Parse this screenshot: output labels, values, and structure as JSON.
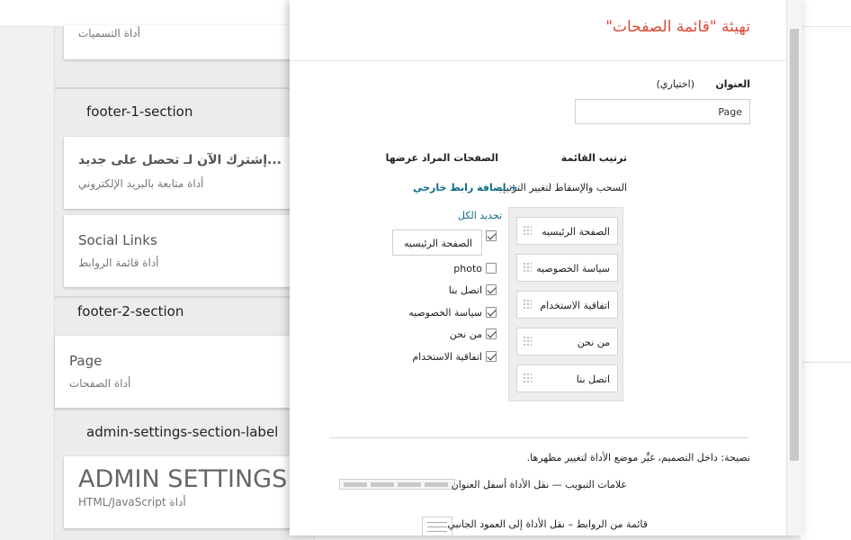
{
  "layout": {
    "gadgets": {
      "labels_gadget_subtitle": "أداة التسميات",
      "footer1_label": "footer-1-section",
      "follow_title": "إشترك الآن لـ تحصل على جديد...",
      "follow_subtitle": "أداة متابعة بالبريد الإلكتروني",
      "social_title": "Social Links",
      "social_subtitle": "أداة قائمة الروابط",
      "footer2_label": "footer-2-section",
      "page_title": "Page",
      "page_subtitle": "أداة الصفحات",
      "admin_label": "admin-settings-section-label",
      "admin_title": "ADMIN SETTINGS",
      "admin_subtitle": "HTML/JavaScript أداة"
    }
  },
  "dialog": {
    "title": "تهيئة \"قائمة الصفحات\"",
    "title_field_label": "العنوان",
    "title_field_optional": "(اختياري)",
    "title_value": "Page",
    "order_header": "ترتيب القائمة",
    "pages_header": "الصفحات المراد عرضها",
    "drag_hint": "السحب والإسقاط لتغيير الترتيب",
    "add_external_link": "+ إضافة رابط خارجي",
    "select_all": "تحديد الكل",
    "order_items": [
      "الصفحة الرئيسيه",
      "سياسة الخصوصيه",
      "اتفاقية الاستخدام",
      "من نحن",
      "اتصل بنا"
    ],
    "home_page_input": "الصفحة الرئيسيه",
    "pages": [
      {
        "label": "photo",
        "checked": false
      },
      {
        "label": "اتصل بنا",
        "checked": true
      },
      {
        "label": "سياسة الخصوصيه",
        "checked": true
      },
      {
        "label": "من نحن",
        "checked": true
      },
      {
        "label": "اتفاقية الاستخدام",
        "checked": true
      }
    ],
    "home_checked": true,
    "tip": "نصيحة: داخل التصميم، غيِّر موضع الأداة لتغيير مظهرها.",
    "tabs_option": "علامات التبويب — نقل الأداة أسفل العنوان",
    "list_option": "قائمة من الروابط – نقل الأداة إلى العمود الجانبي"
  },
  "colors": {
    "accent_title": "#dd4b39",
    "link": "#0b6e86"
  }
}
